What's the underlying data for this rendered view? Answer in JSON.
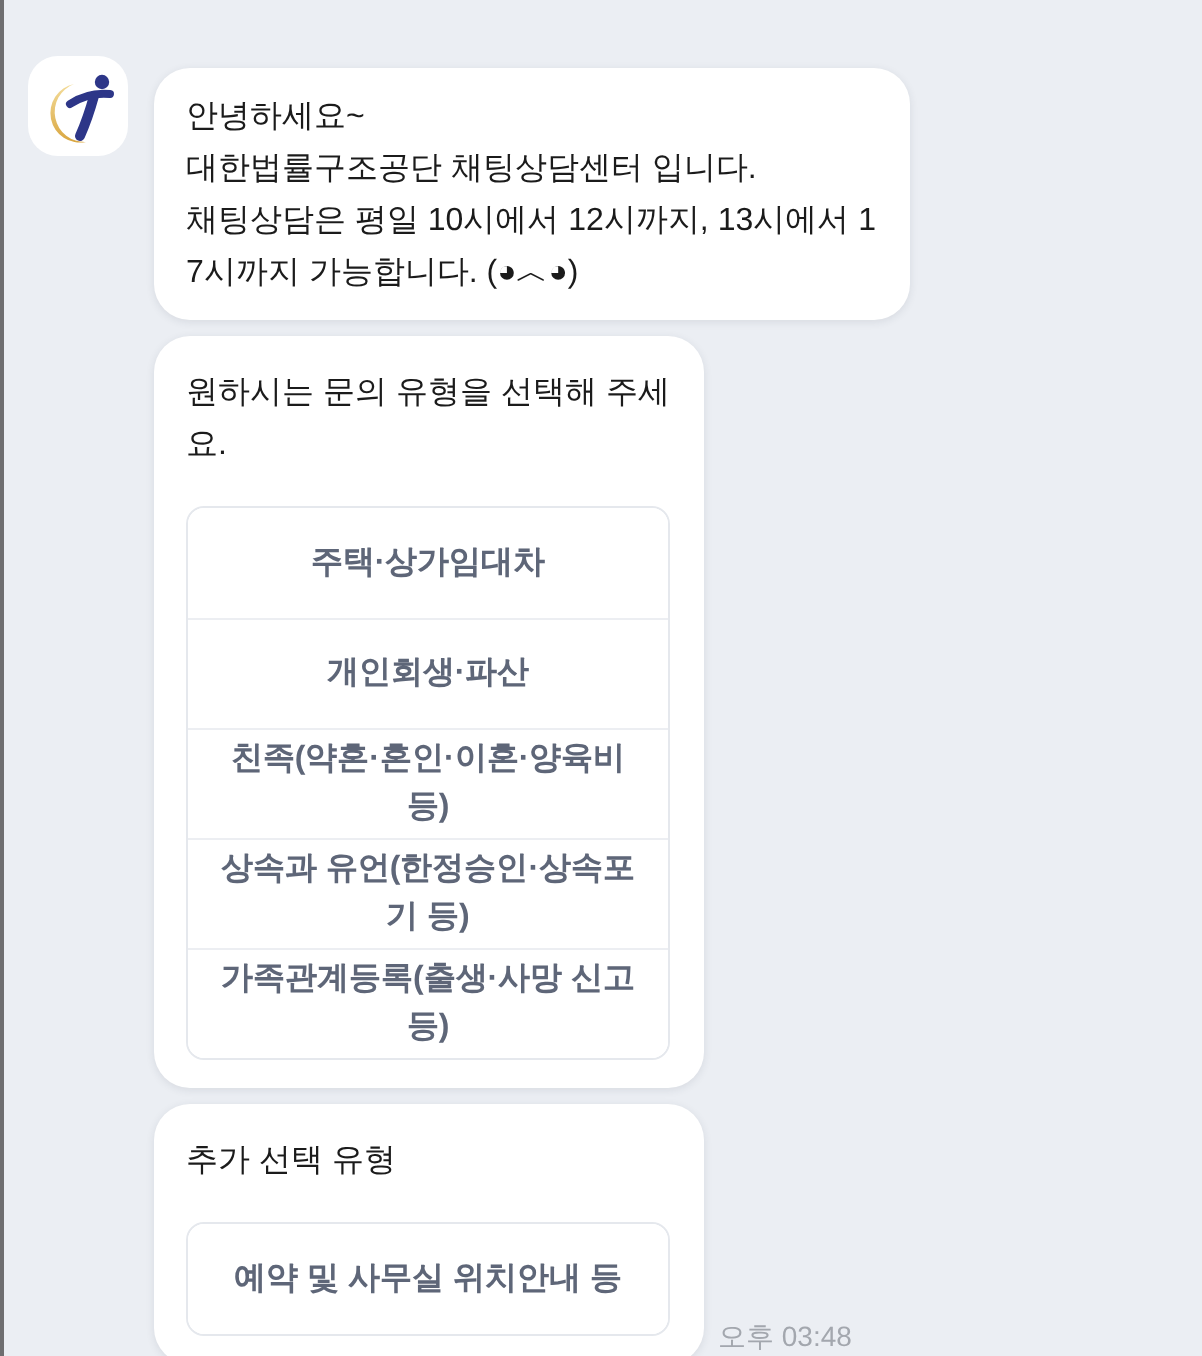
{
  "messages": [
    {
      "kind": "text",
      "text": "안녕하세요~\n대한법률구조공단 채팅상담센터 입니다.\n채팅상담은 평일 10시에서 12시까지, 13시에서 17시까지 가능합니다. (◕︿◕)"
    },
    {
      "kind": "choices",
      "text": "원하시는 문의 유형을 선택해 주세요.",
      "options": [
        "주택·상가임대차",
        "개인회생·파산",
        "친족(약혼·혼인·이혼·양육비 등)",
        "상속과 유언(한정승인·상속포기 등)",
        "가족관계등록(출생·사망 신고 등)"
      ]
    },
    {
      "kind": "choices",
      "text": "추가 선택 유형",
      "options": [
        "예약 및 사무실 위치안내 등"
      ],
      "time": "오후 03:48"
    }
  ]
}
